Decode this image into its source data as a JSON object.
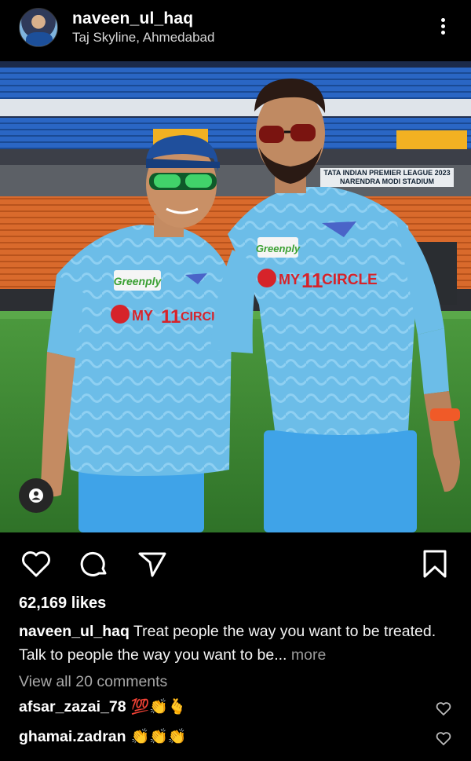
{
  "post": {
    "username": "naveen_ul_haq",
    "location": "Taj Skyline, Ahmedabad",
    "photo": {
      "stadium_sign_1": "TATA INDIAN PREMIER LEAGUE 2023",
      "stadium_sign_2": "NARENDRA MODI STADIUM",
      "sponsor_1": "Greenply",
      "sponsor_2": "MY",
      "sponsor_3": "11",
      "sponsor_4": "CIRCLE"
    },
    "likes": "62,169 likes",
    "caption_username": "naveen_ul_haq",
    "caption_text": "Treat people the way you want to be treated. Talk to people the way you want to be...",
    "caption_more": "more",
    "view_comments": "View all 20 comments",
    "comments": [
      {
        "username": "afsar_zazai_78",
        "text": "💯👏🫰"
      },
      {
        "username": "ghamai.zadran",
        "text": "👏👏👏"
      }
    ]
  },
  "icons": {
    "more": "more-options-icon",
    "like": "heart-icon",
    "comment": "comment-bubble-icon",
    "share": "paper-plane-icon",
    "save": "bookmark-icon",
    "tags": "person-tag-icon"
  },
  "colors": {
    "background": "#000000",
    "text": "#f5f5f5",
    "secondary_text": "#a8a8a8",
    "jersey": "#5fb3e3",
    "shorts": "#3fa3e8",
    "field": "#3f8a34",
    "seats_orange": "#e07a3a",
    "seats_blue": "#1f5db0"
  }
}
